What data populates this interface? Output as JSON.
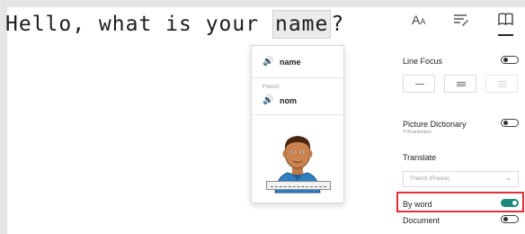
{
  "sentence": {
    "before": "Hello, what is your",
    "highlight": "name",
    "after": "?"
  },
  "popup": {
    "source_word": "name",
    "translation_language": "French",
    "translation_word": "nom",
    "speaker_icon": "speaker-icon"
  },
  "toolbar": {
    "text_options_icon": "text-size-icon",
    "grammar_icon": "grammar-icon",
    "reading_prefs_icon": "book-icon"
  },
  "settings": {
    "line_focus": {
      "label": "Line Focus",
      "toggle": false
    },
    "picture_dictionary": {
      "label": "Picture Dictionary",
      "sub": "® Boardmaker",
      "toggle": false
    },
    "translate": {
      "label": "Translate",
      "language": "French (France)"
    },
    "by_word": {
      "label": "By word",
      "toggle": true
    },
    "document": {
      "label": "Document",
      "toggle": false
    }
  },
  "colors": {
    "accent": "#1f8a7a",
    "callout": "#e0303a"
  }
}
